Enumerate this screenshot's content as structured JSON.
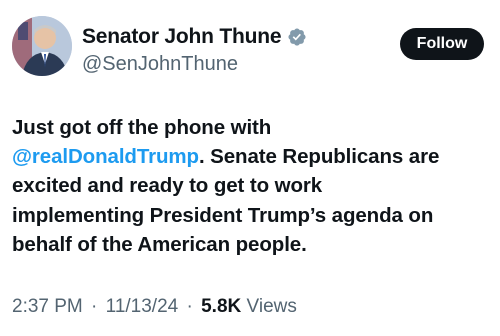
{
  "author": {
    "display_name": "Senator John Thune",
    "handle": "@SenJohnThune",
    "verified_icon": "verified-badge-icon"
  },
  "follow_label": "Follow",
  "tweet": {
    "line1": "Just got off the phone with",
    "mention": "@realDonaldTrump",
    "line2_rest": ". Senate Republicans are",
    "line3": "excited and ready to get to work",
    "line4": "implementing President Trump’s agenda on",
    "line5": "behalf of the American people."
  },
  "meta": {
    "time": "2:37 PM",
    "separator": "·",
    "date": "11/13/24",
    "views_count": "5.8K",
    "views_label": "Views"
  },
  "colors": {
    "accent": "#1d9bf0",
    "text": "#0f1419",
    "secondary": "#536471"
  }
}
